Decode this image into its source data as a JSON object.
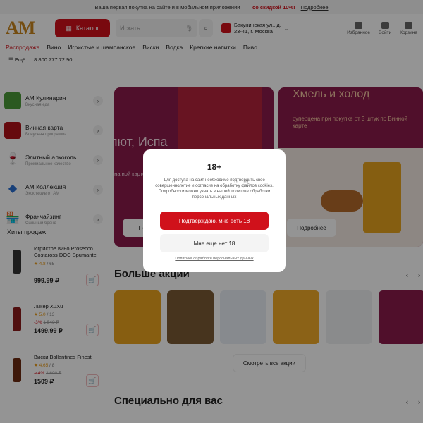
{
  "promo": {
    "text": "Ваша первая покупка на сайте и в мобильном приложении —",
    "highlight": "со скидкой 10%!",
    "link": "Подробнее"
  },
  "header": {
    "logo": "AM",
    "catalog": "Каталог",
    "search_placeholder": "Искать...",
    "address_line1": "Бакунинская ул., д.",
    "address_line2": "23-41, г. Москва",
    "favorites": "Избранное",
    "login": "Войти",
    "cart": "Корзина"
  },
  "nav": [
    "Распродажа",
    "Вино",
    "Игристые и шампанское",
    "Виски",
    "Водка",
    "Крепкие напитки",
    "Пиво"
  ],
  "nav2": {
    "more": "Ещё",
    "phone": "8 800 777 72 90"
  },
  "sidebar": [
    {
      "title": "АМ Кулинария",
      "sub": "Вкусная еда",
      "color": "#4b9a38"
    },
    {
      "title": "Винная карта",
      "sub": "Бонусная программа",
      "color": "#b01219"
    },
    {
      "title": "Элитный алкоголь",
      "sub": "Премиальное качество",
      "color": "#ffffff"
    },
    {
      "title": "АМ Коллекция",
      "sub": "Эксклюзив от АМ",
      "color": "#ffffff"
    },
    {
      "title": "Франчайзинг",
      "sub": "Сильный бренд",
      "color": "#ffffff"
    }
  ],
  "hits_title": "Хиты продаж",
  "products": [
    {
      "name": "Игристое вино Prosecco Costaross DOC Spumante",
      "rating": "4.8",
      "reviews": "/ 65",
      "discount": "",
      "old_price": "",
      "price": "999.99 ₽"
    },
    {
      "name": "Ликер XuXu",
      "rating": "5.0",
      "reviews": "/ 13",
      "discount": "-3%",
      "old_price": "1 549 ₽",
      "price": "1499.99 ₽"
    },
    {
      "name": "Виски Ballantines Finest",
      "rating": "4.65",
      "reviews": "/ 8",
      "discount": "-44%",
      "old_price": "2 690 ₽",
      "price": "1509 ₽"
    }
  ],
  "banners": {
    "b1_big": "лют, Испа",
    "b1_small": "ена ной карте",
    "b1_btn": "Под",
    "b2_title": "Хмель и холод",
    "b2_sub": "суперцена при покупке от 3 штук по Винной карте",
    "b2_btn": "Подробнее"
  },
  "more_promos": {
    "title": "Больше акций",
    "button": "Смотреть все акции"
  },
  "special": {
    "title": "Специально для вас"
  },
  "modal": {
    "title": "18+",
    "text": "Для доступа на сайт необходимо подтвердить свое совершеннолетие и согласие на обработку файлов cookies. Подробности можно узнать в нашей политике обработки персональных данных",
    "confirm": "Подтверждаю, мне есть 18",
    "deny": "Мне еще нет 18",
    "policy": "Политика обработки персональных данных"
  },
  "colors": {
    "accent": "#d0111b",
    "brand_gold": "#c8861e",
    "banner": "#8a1a4a"
  }
}
